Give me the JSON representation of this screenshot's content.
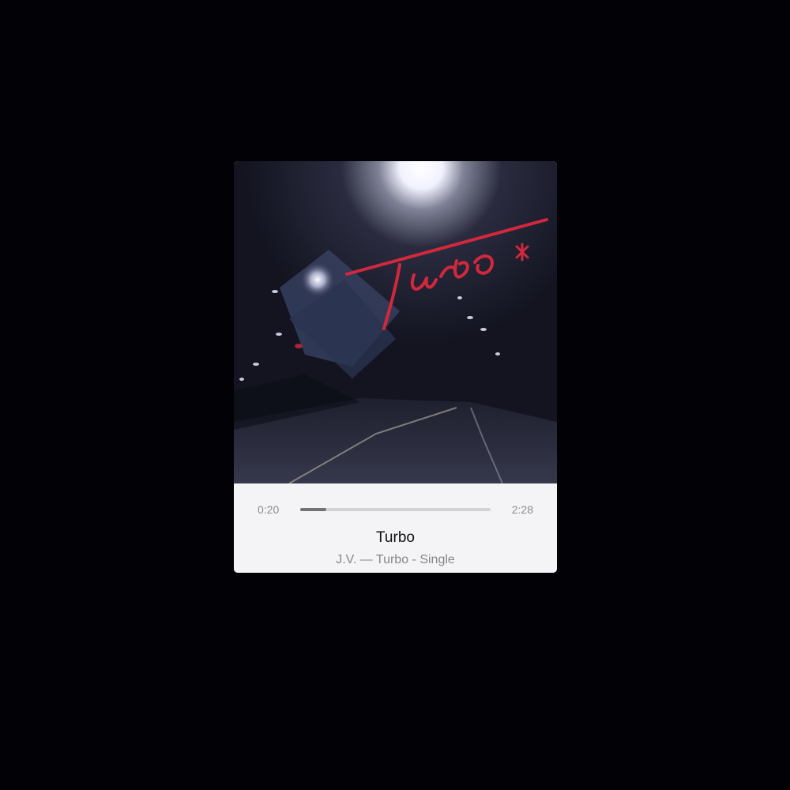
{
  "player": {
    "elapsed": "0:20",
    "duration": "2:28",
    "progress": 0.135,
    "track_title": "Turbo",
    "subtitle": "J.V. — Turbo - Single"
  },
  "artwork": {
    "logo_text": "Turbo*",
    "logo_color": "#d2283d"
  },
  "colors": {
    "background": "#020106",
    "panel": "#f4f4f6",
    "progress_track": "#d3d3d7",
    "progress_fill": "#727277"
  }
}
